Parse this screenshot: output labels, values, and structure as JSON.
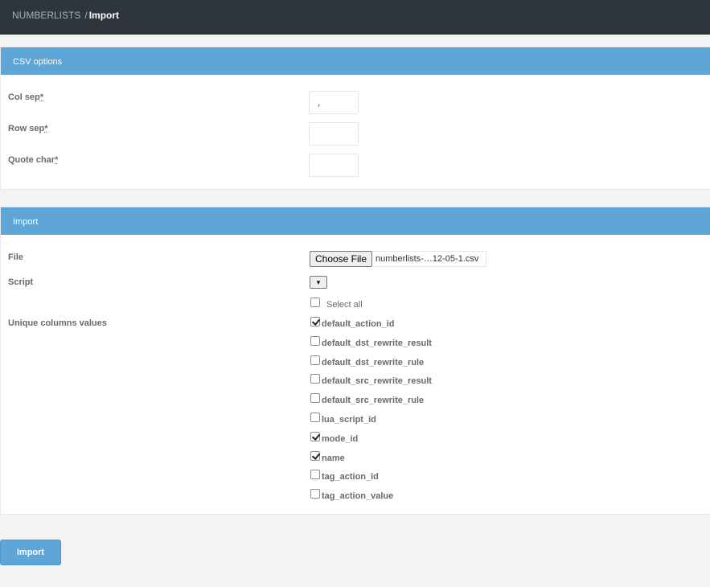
{
  "breadcrumb": {
    "parent": "NUMBERLISTS",
    "separator": "/",
    "current": "Import"
  },
  "csv_options": {
    "title": "CSV options",
    "col_sep": {
      "label": "Col sep",
      "required_mark": "*",
      "value": ","
    },
    "row_sep": {
      "label": "Row sep",
      "required_mark": "*",
      "value": ""
    },
    "quote_char": {
      "label": "Quote char",
      "required_mark": "*",
      "value": ""
    }
  },
  "import_panel": {
    "title": "Import",
    "file": {
      "label": "File",
      "button_label": "Choose File",
      "file_name": "numberlists-…12-05-1.csv"
    },
    "script": {
      "label": "Script",
      "dropdown_glyph": "▾"
    },
    "unique_columns": {
      "label": "Unique columns values",
      "select_all_label": "Select all",
      "select_all_checked": false,
      "columns": [
        {
          "name": "default_action_id",
          "checked": true
        },
        {
          "name": "default_dst_rewrite_result",
          "checked": false
        },
        {
          "name": "default_dst_rewrite_rule",
          "checked": false
        },
        {
          "name": "default_src_rewrite_result",
          "checked": false
        },
        {
          "name": "default_src_rewrite_rule",
          "checked": false
        },
        {
          "name": "lua_script_id",
          "checked": false
        },
        {
          "name": "mode_id",
          "checked": true
        },
        {
          "name": "name",
          "checked": true
        },
        {
          "name": "tag_action_id",
          "checked": false
        },
        {
          "name": "tag_action_value",
          "checked": false
        }
      ]
    }
  },
  "submit": {
    "label": "Import"
  },
  "colors": {
    "accent": "#5ea5d8",
    "topbar": "#2f353c",
    "text": "#676a6c"
  }
}
